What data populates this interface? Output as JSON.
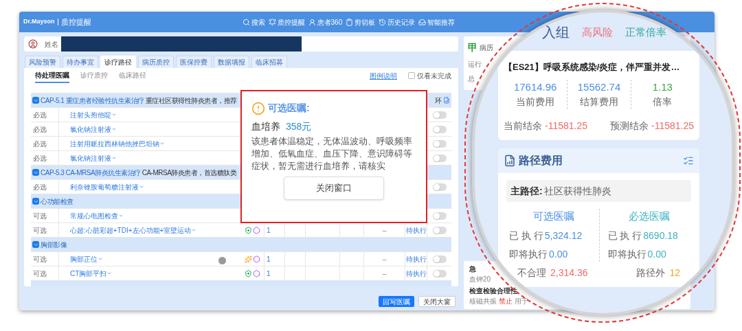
{
  "window": {
    "logo": "Dr.Mayson",
    "title": "质控提醒"
  },
  "toolbar": [
    {
      "label": "搜索",
      "kind": "search"
    },
    {
      "label": "质控提醒",
      "kind": "bell"
    },
    {
      "label": "患者360",
      "kind": "person"
    },
    {
      "label": "剪切板",
      "kind": "clipboard"
    },
    {
      "label": "历史记录",
      "kind": "history"
    },
    {
      "label": "智能推荐",
      "kind": "tray"
    }
  ],
  "patient": {
    "label": "姓名"
  },
  "tabs": [
    {
      "label": "风险预警",
      "selected": false
    },
    {
      "label": "待办事宜",
      "selected": false
    },
    {
      "label": "诊疗路径",
      "selected": true
    },
    {
      "label": "病历质控",
      "selected": false
    },
    {
      "label": "医保控费",
      "selected": false
    },
    {
      "label": "数据填报",
      "selected": false
    },
    {
      "label": "临床招募",
      "selected": false
    }
  ],
  "subtabs": [
    {
      "label": "待处理医嘱",
      "selected": true
    },
    {
      "label": "诊疗质控",
      "selected": false
    },
    {
      "label": "临床路径",
      "selected": false
    }
  ],
  "legend_link": "图例说明",
  "filter": {
    "label": "仅看未完成",
    "checked": false
  },
  "column_tail": "环",
  "groups": [
    {
      "title": "CAP-5.1 重症患者经验性抗生素治疗",
      "note": "重症社区获得性肺炎患者，推荐",
      "expanded": true,
      "rows": [
        {
          "type": "必选",
          "name": "注射头孢他啶",
          "on": false
        },
        {
          "type": "必选",
          "name": "氯化钠注射液",
          "on": false
        },
        {
          "type": "必选",
          "name": "注射用哌拉西林钠他挫巴坦钠",
          "on": false
        },
        {
          "type": "必选",
          "name": "氯化钠注射液",
          "on": false
        }
      ]
    },
    {
      "title": "CAP-5.3 CA-MRSA肺炎抗生素治疗",
      "note": "CA-MRSA肺炎患者，首选糖肽类",
      "expanded": true,
      "rows": [
        {
          "type": "必选",
          "name": "利奈锉胺葡萄糖注射液",
          "on": false
        }
      ]
    },
    {
      "title": "心功能检查",
      "expanded": true,
      "rows": [
        {
          "type": "可选",
          "name": "常规心电图检查",
          "on": false
        },
        {
          "type": "可选",
          "name": "心超:心脏彩超+TDI+左心功能+室壁运动",
          "badges": [
            {
              "kind": "shield"
            },
            {
              "kind": "hex"
            }
          ],
          "count": "1",
          "dash": "–",
          "status": "待执行",
          "on": false
        }
      ]
    },
    {
      "title": "胸部影像",
      "expanded": true,
      "rows": [
        {
          "type": "可选",
          "name": "胸部正位",
          "badges": [
            {
              "kind": "star"
            },
            {
              "kind": "hex"
            }
          ],
          "count": "1",
          "dash": "–",
          "status": "待执行",
          "on": false
        },
        {
          "type": "可选",
          "name": "CT胸部平扫",
          "badges": [
            {
              "kind": "shield"
            },
            {
              "kind": "hex"
            }
          ],
          "count": "1",
          "dash": "–",
          "status": "待执行",
          "on": false
        }
      ]
    }
  ],
  "popup": {
    "title": "可选医嘱:",
    "item": "血培养",
    "price": "358元",
    "message": "该患者体温稳定，无体温波动、呼吸频率增加、低氧血症、血压下降、意识障碍等症状，暂无需进行血培养，请核实",
    "button": "关闭窗口"
  },
  "footer_buttons": [
    {
      "label": "回写医嘱",
      "kind": "primary"
    },
    {
      "label": "关闭大窗",
      "kind": "secondary"
    }
  ],
  "sidebar": {
    "badge": "甲",
    "title": "病历",
    "lines": [
      "运行",
      "总"
    ],
    "alerts": [
      {
        "title": "急",
        "detail": "血钾20"
      },
      {
        "title": "检查检验合理性",
        "before": "核磁共振",
        "warn": "禁止",
        "after": "用于"
      }
    ]
  },
  "magnifier": {
    "group_label": "入组",
    "tags": [
      {
        "label": "高风险",
        "color": "#f0707a"
      },
      {
        "label": "正常倍率",
        "color": "#2fa79b"
      }
    ],
    "drg": {
      "title": "【ES21】呼吸系统感染/炎症，伴严重并发…",
      "stats": [
        {
          "value": "17614.96",
          "label": "当前费用",
          "color": "#4a8ee6"
        },
        {
          "value": "15562.74",
          "label": "结算费用",
          "color": "#4a8ee6"
        },
        {
          "value": "1.13",
          "label": "倍率",
          "color": "#3fa34d"
        }
      ],
      "balances": [
        {
          "label": "当前结余",
          "value": "-11581.25"
        },
        {
          "label": "预测结余",
          "value": "-11581.25"
        }
      ]
    },
    "path_cost": {
      "title": "路径费用",
      "main_label": "主路径:",
      "main_value": "社区获得性肺炎",
      "columns": [
        {
          "title": "可选医嘱",
          "color": "#4a8ee6",
          "rows": [
            {
              "label": "已 执 行",
              "value": "5,324.12"
            },
            {
              "label": "即将执行",
              "value": "0.00"
            }
          ]
        },
        {
          "title": "必选医嘱",
          "color": "#3db3c2",
          "rows": [
            {
              "label": "已 执 行",
              "value": "8690.18"
            },
            {
              "label": "即将执行",
              "value": "0.00"
            }
          ]
        }
      ],
      "totals": [
        {
          "label": "不合理",
          "value": "2,314.36",
          "color": "#f06a6a"
        },
        {
          "label": "路径外",
          "value": "12",
          "color": "#f5a623"
        }
      ]
    }
  }
}
